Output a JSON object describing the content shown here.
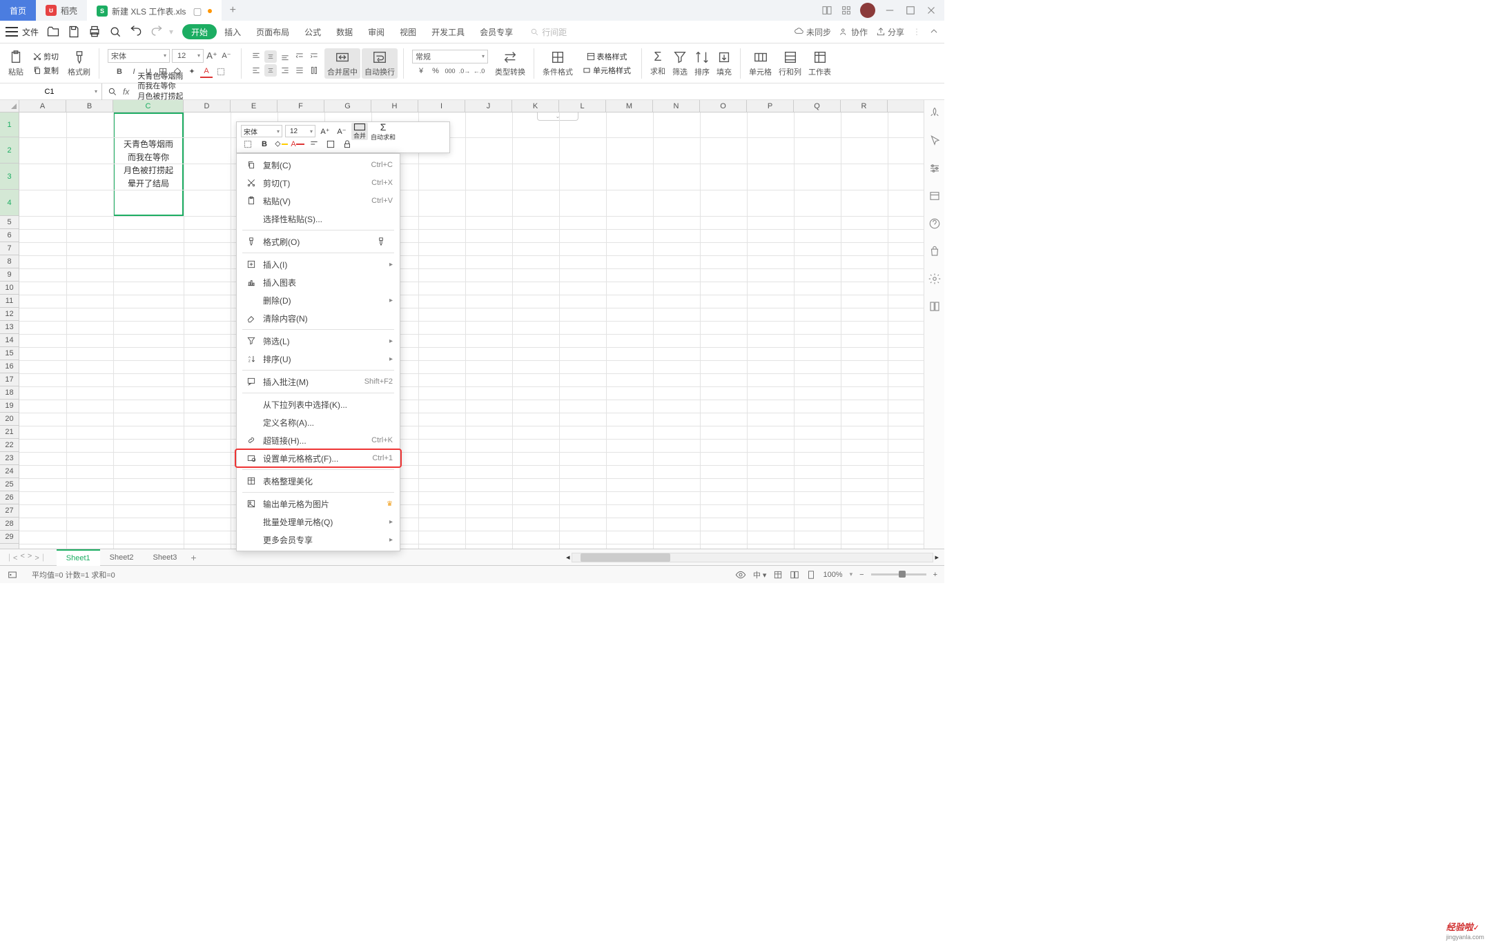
{
  "titlebar": {
    "home": "首页",
    "docker": "稻壳",
    "file": "新建 XLS 工作表.xls"
  },
  "menubar": {
    "file": "文件",
    "tabs": [
      "开始",
      "插入",
      "页面布局",
      "公式",
      "数据",
      "审阅",
      "视图",
      "开发工具",
      "会员专享"
    ],
    "search_placeholder": "行间距",
    "right": {
      "unsync": "未同步",
      "collab": "协作",
      "share": "分享"
    }
  },
  "toolbar": {
    "paste": "粘贴",
    "cut": "剪切",
    "copy": "复制",
    "format_painter": "格式刷",
    "font": "宋体",
    "size": "12",
    "merge": "合并居中",
    "wrap": "自动换行",
    "number_format": "常规",
    "type_convert": "类型转换",
    "cond_format": "条件格式",
    "table_style": "表格样式",
    "cell_style": "单元格样式",
    "sum": "求和",
    "filter": "筛选",
    "sort": "排序",
    "fill": "填充",
    "cells": "单元格",
    "rowscols": "行和列",
    "worksheet": "工作表"
  },
  "namebox": "C1",
  "formula_text": "天青色等烟雨\n而我在等你\n月色被打捞起\n晕开了结局",
  "columns": [
    "A",
    "B",
    "C",
    "D",
    "E",
    "F",
    "G",
    "H",
    "I",
    "J",
    "K",
    "L",
    "M",
    "N",
    "O",
    "P",
    "Q",
    "R"
  ],
  "cell_content": [
    "天青色等烟雨",
    "而我在等你",
    "月色被打捞起",
    "晕开了结局"
  ],
  "mini": {
    "font": "宋体",
    "size": "12",
    "merge": "合并",
    "sum": "自动求和"
  },
  "context_menu": [
    {
      "label": "复制(C)",
      "shortcut": "Ctrl+C",
      "icon": "copy"
    },
    {
      "label": "剪切(T)",
      "shortcut": "Ctrl+X",
      "icon": "cut"
    },
    {
      "label": "粘贴(V)",
      "shortcut": "Ctrl+V",
      "icon": "paste"
    },
    {
      "label": "选择性粘贴(S)...",
      "icon": ""
    },
    {
      "sep": true
    },
    {
      "label": "格式刷(O)",
      "icon": "brush",
      "trail": "brush2"
    },
    {
      "sep": true
    },
    {
      "label": "插入(I)",
      "icon": "insert",
      "sub": true
    },
    {
      "label": "插入图表",
      "icon": "chart"
    },
    {
      "label": "删除(D)",
      "icon": "",
      "sub": true
    },
    {
      "label": "清除内容(N)",
      "icon": "eraser"
    },
    {
      "sep": true
    },
    {
      "label": "筛选(L)",
      "icon": "filter",
      "sub": true
    },
    {
      "label": "排序(U)",
      "icon": "sort",
      "sub": true
    },
    {
      "sep": true
    },
    {
      "label": "插入批注(M)",
      "shortcut": "Shift+F2",
      "icon": "comment"
    },
    {
      "sep": true
    },
    {
      "label": "从下拉列表中选择(K)...",
      "icon": ""
    },
    {
      "label": "定义名称(A)...",
      "icon": ""
    },
    {
      "label": "超链接(H)...",
      "shortcut": "Ctrl+K",
      "icon": "link"
    },
    {
      "label": "设置单元格格式(F)...",
      "shortcut": "Ctrl+1",
      "icon": "cellfmt",
      "highlight": true
    },
    {
      "sep": true
    },
    {
      "label": "表格整理美化",
      "icon": "table"
    },
    {
      "sep": true
    },
    {
      "label": "输出单元格为图片",
      "icon": "image",
      "crown": true
    },
    {
      "label": "批量处理单元格(Q)",
      "icon": "",
      "sub": true
    },
    {
      "label": "更多会员专享",
      "icon": "",
      "sub": true
    }
  ],
  "sheets": [
    "Sheet1",
    "Sheet2",
    "Sheet3"
  ],
  "statusbar": {
    "stats": "平均值=0  计数=1  求和=0",
    "zoom": "100%"
  },
  "watermark": {
    "main": "经验啦",
    "sub": "jingyanla.com"
  }
}
